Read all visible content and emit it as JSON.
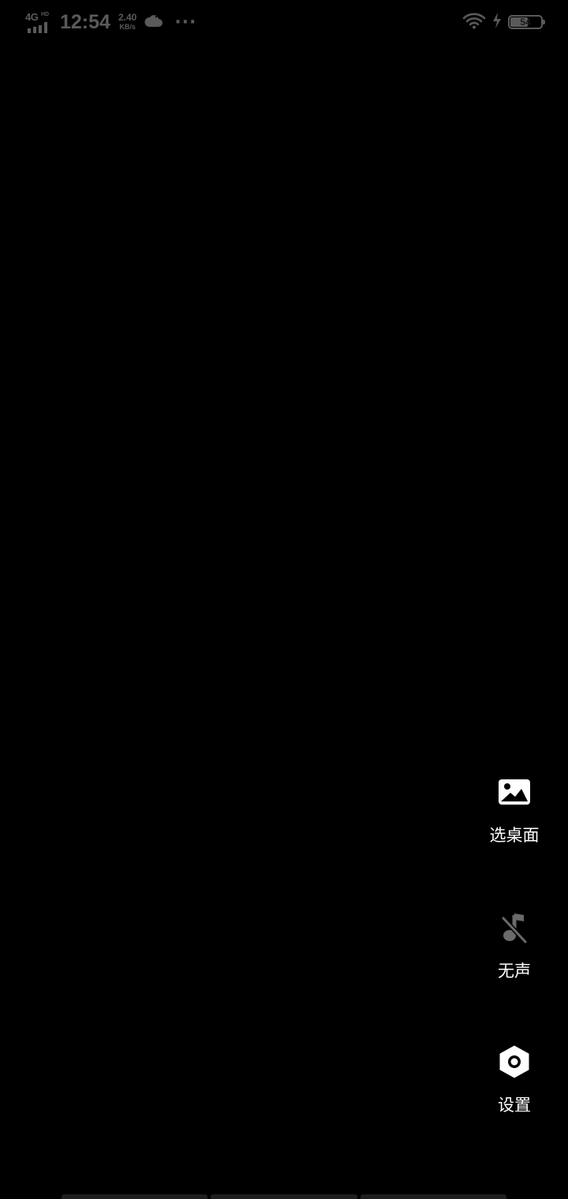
{
  "status_bar": {
    "network_type": "4G",
    "network_badge": "HD",
    "time": "12:54",
    "net_speed_value": "2.40",
    "net_speed_unit": "KB/s",
    "more_indicator": "···",
    "battery_percent": "54",
    "icons": {
      "weather": "cloud-icon",
      "wifi": "wifi-icon",
      "charging": "lightning-icon"
    },
    "color": "#5a5a5a"
  },
  "actions": [
    {
      "label": "选桌面",
      "icon": "image-icon"
    },
    {
      "label": "无声",
      "icon": "music-off-icon"
    },
    {
      "label": "设置",
      "icon": "settings-hex-icon"
    }
  ]
}
